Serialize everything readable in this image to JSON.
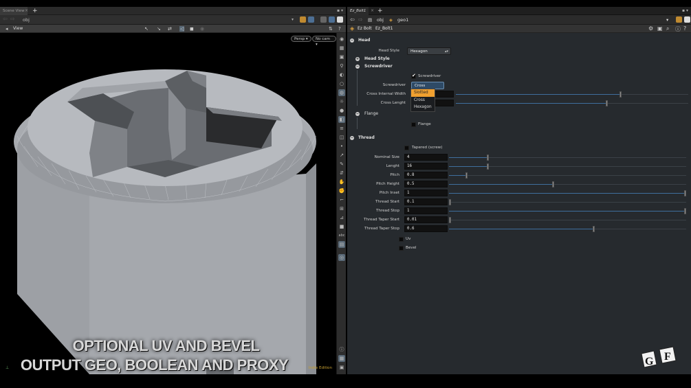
{
  "left": {
    "tab_label": "Scene View",
    "path_label": "obj",
    "view_label": "View",
    "persp_label": "Persp",
    "cam_label": "No cam",
    "indie_label": "Indie Edition",
    "overlay_line1": "OPTIONAL UV AND BEVEL",
    "overlay_line2": "OUTPUT GEO, BOOLEAN AND PROXY"
  },
  "right": {
    "tab_label": "Ez_Bolt1",
    "path_obj": "obj",
    "path_geo": "geo1",
    "node_type": "Ez Bolt",
    "node_name": "Ez_Bolt1"
  },
  "params": {
    "head_folder": "Head",
    "head_style_label": "Head Style",
    "head_style_value": "Hexagon",
    "head_style_sub": "Head Style",
    "screwdriver_folder": "Screwdriver",
    "screwdriver_toggle_label": "Screwdriver",
    "screwdriver_label": "Screwdriver",
    "screwdriver_value": "Cross",
    "screwdriver_options": [
      "Slotted",
      "Cross",
      "Hexagon"
    ],
    "screwdriver_highlight": "Slotted",
    "cross_width_label": "Cross Internal Width",
    "cross_length_label": "Cross Lenght",
    "flange_folder": "Flange",
    "flange_toggle_label": "Flange",
    "thread_folder": "Thread",
    "tapered_label": "Tapered (screw)",
    "thread_params": [
      {
        "label": "Nominal Size",
        "value": "4",
        "slider": 0.16
      },
      {
        "label": "Lenght",
        "value": "16",
        "slider": 0.16
      },
      {
        "label": "Pitch",
        "value": "0.8",
        "slider": 0.07
      },
      {
        "label": "Pitch Height",
        "value": "0.5",
        "slider": 0.44
      },
      {
        "label": "Pitch Inset",
        "value": "1",
        "slider": 1.0
      },
      {
        "label": "Thread Start",
        "value": "0.1",
        "slider": 0.0
      },
      {
        "label": "Thread Stop",
        "value": "1",
        "slider": 1.0
      },
      {
        "label": "Thread Taper Start",
        "value": "0.01",
        "slider": 0.0
      },
      {
        "label": "Thread Taper Stop",
        "value": "0.6",
        "slider": 0.61
      }
    ],
    "uv_label": "Uv",
    "bevel_label": "Bevel"
  },
  "colors": {
    "accent": "#f0a030",
    "slider_fill": "#3f6f9e"
  }
}
